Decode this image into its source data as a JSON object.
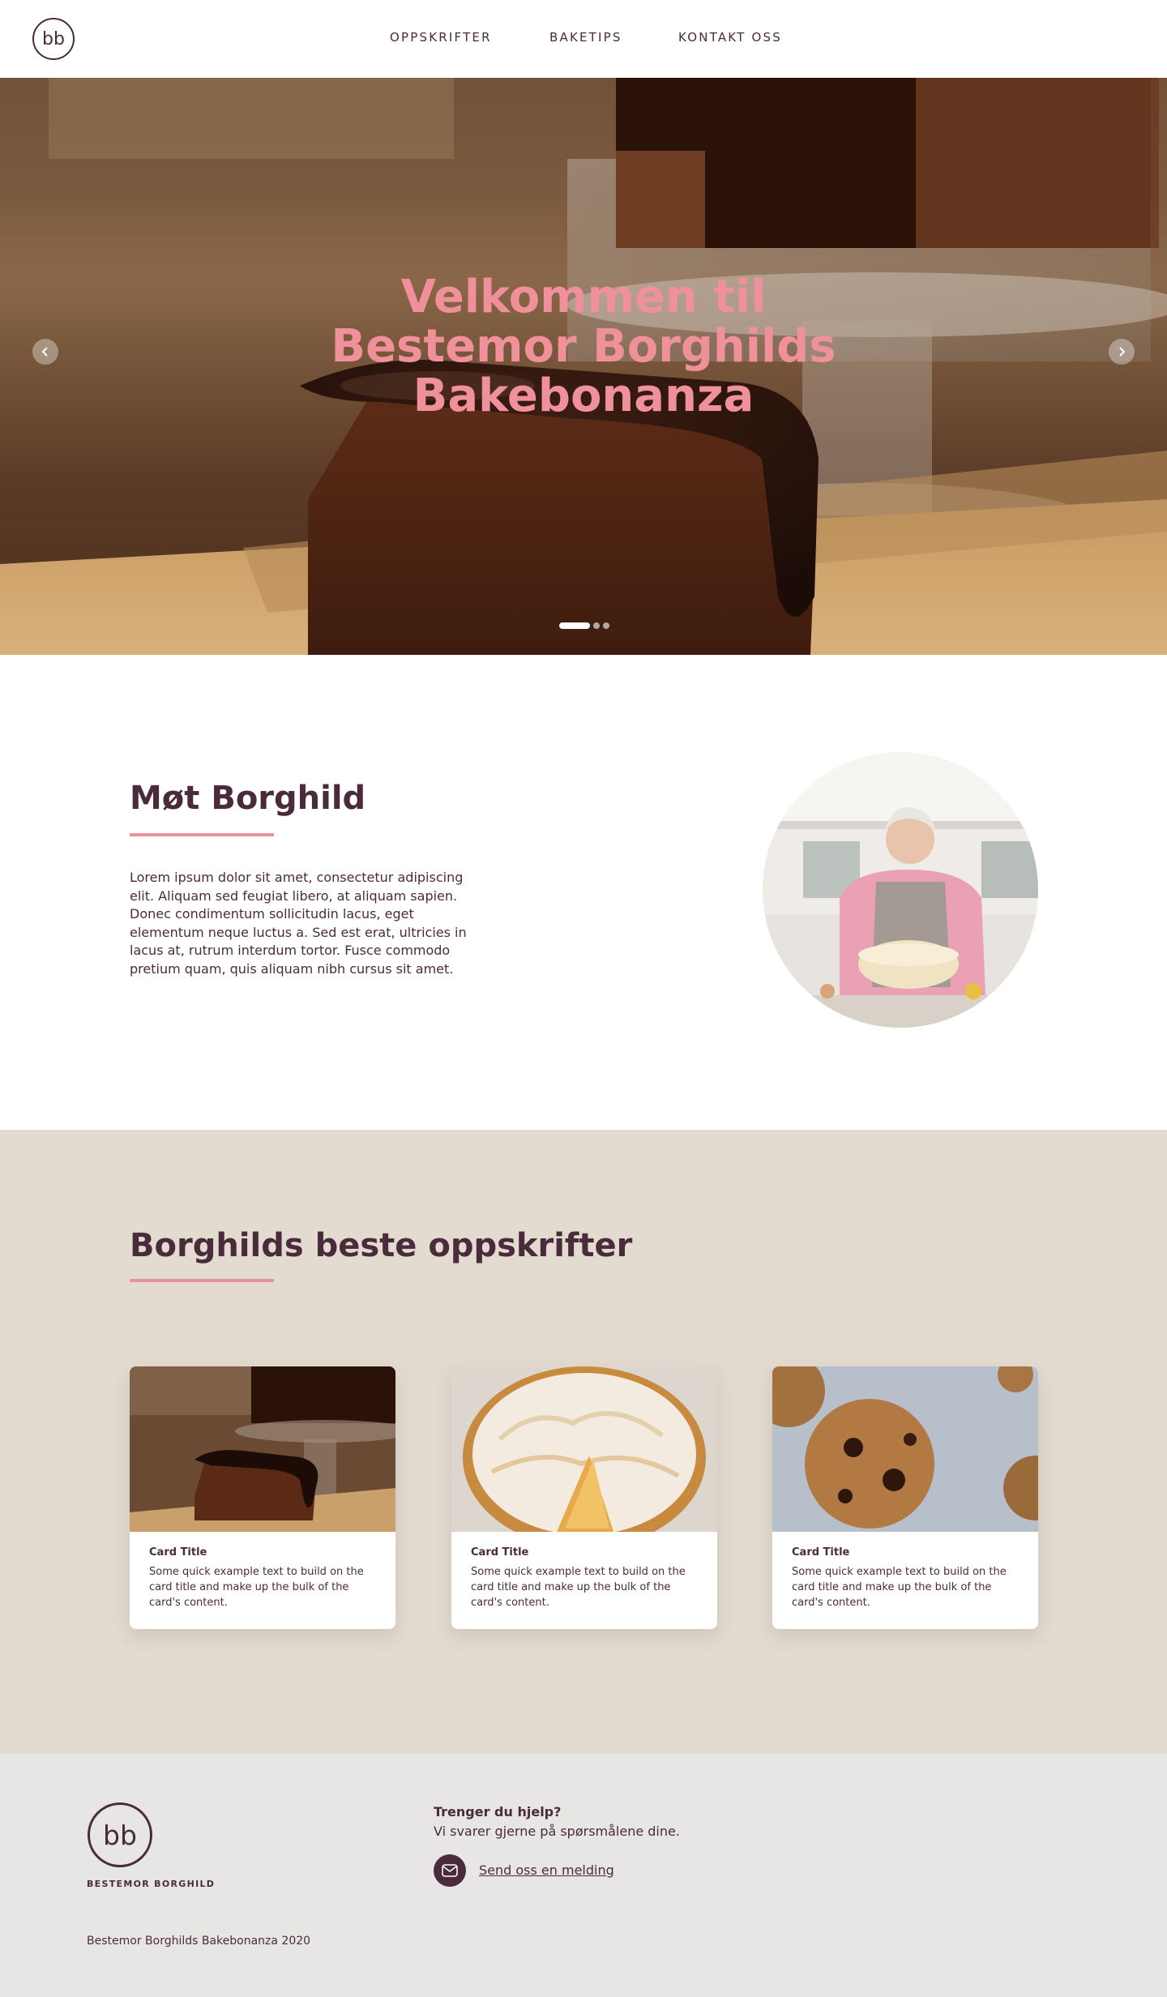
{
  "header": {
    "logo_text": "bb",
    "nav": [
      "OPPSKRIFTER",
      "BAKETIPS",
      "KONTAKT OSS"
    ]
  },
  "hero": {
    "title": "Velkommen til Bestemor Borghilds Bakebonanza",
    "prev_icon": "chevron-left-icon",
    "next_icon": "chevron-right-icon",
    "slides": 3,
    "active_slide": 1
  },
  "about": {
    "title": "Møt Borghild",
    "text": "Lorem ipsum dolor sit amet, consectetur adipiscing elit. Aliquam sed feugiat libero, at aliquam sapien. Donec condimentum sollicitudin lacus, eget elementum neque luctus a. Sed est erat, ultricies in lacus at, rutrum interdum tortor. Fusce commodo pretium quam, quis aliquam nibh cursus sit amet."
  },
  "recipes": {
    "title": "Borghilds beste oppskrifter",
    "cards": [
      {
        "title": "Card Title",
        "text": "Some quick example text to build on the card title and make up the bulk of the card's content."
      },
      {
        "title": "Card Title",
        "text": "Some quick example text to build on the card title and make up the bulk of the card's content."
      },
      {
        "title": "Card Title",
        "text": "Some quick example text to build on the card title and make up the bulk of the card's content."
      }
    ]
  },
  "footer": {
    "logo_text": "bb",
    "brand": "BESTEMOR BORGHILD",
    "help_question": "Trenger du hjelp?",
    "help_answer": "Vi svarer gjerne på spørsmålene dine.",
    "mail_icon": "envelope-icon",
    "mail_link": "Send oss en melding",
    "copyright": "Bestemor Borghilds Bakebonanza 2020"
  },
  "colors": {
    "primary": "#4a2b3c",
    "accent": "#e8939b",
    "hero_title": "#f0909a",
    "recipes_bg": "#e3dbd0",
    "footer_bg": "#e8e6e4"
  }
}
